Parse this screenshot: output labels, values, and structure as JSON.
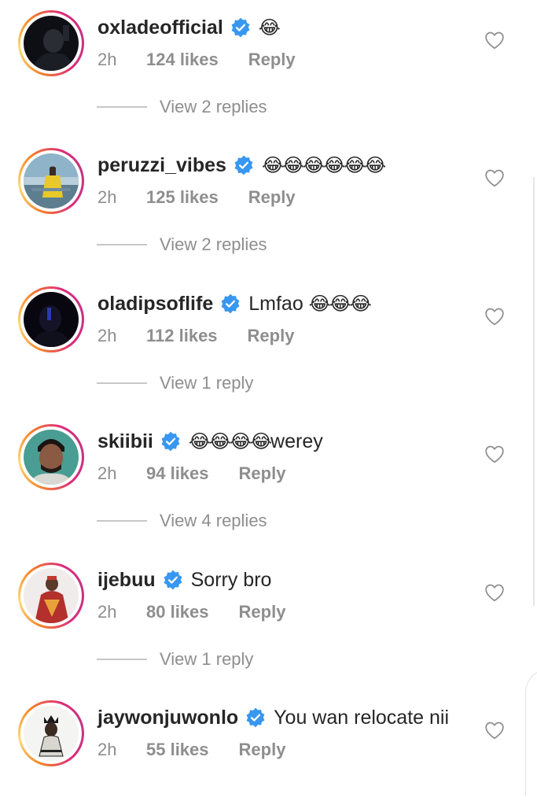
{
  "comments": [
    {
      "username": "oxladeofficial",
      "text": "",
      "emojis": "😂",
      "time": "2h",
      "likes": "124 likes",
      "reply": "Reply",
      "view_replies": "View 2 replies",
      "avatar": "dark-portrait"
    },
    {
      "username": "peruzzi_vibes",
      "text": "",
      "emojis": "😂😂😂😂😂😂",
      "time": "2h",
      "likes": "125 likes",
      "reply": "Reply",
      "view_replies": "View 2 replies",
      "avatar": "yellow-outfit-stadium"
    },
    {
      "username": "oladipsoflife",
      "text": "Lmfao ",
      "emojis": "😂😂😂",
      "time": "2h",
      "likes": "112 likes",
      "reply": "Reply",
      "view_replies": "View 1 reply",
      "avatar": "night-portrait"
    },
    {
      "username": "skiibii",
      "text": "werey",
      "emojis": "😂😂😂😂",
      "time": "2h",
      "likes": "94 likes",
      "reply": "Reply",
      "view_replies": "View 4 replies",
      "avatar": "man-closeup"
    },
    {
      "username": "ijebuu",
      "text": "Sorry bro",
      "emojis": "",
      "time": "2h",
      "likes": "80 likes",
      "reply": "Reply",
      "view_replies": "View 1 reply",
      "avatar": "red-agbada"
    },
    {
      "username": "jaywonjuwonlo",
      "text": "You wan relocate nii",
      "emojis": "",
      "time": "2h",
      "likes": "55 likes",
      "reply": "Reply",
      "view_replies": "",
      "avatar": "crowned-figure"
    }
  ],
  "colors": {
    "verified": "#3897f0",
    "secondary_text": "#8e8e8e",
    "primary_text": "#262626"
  }
}
